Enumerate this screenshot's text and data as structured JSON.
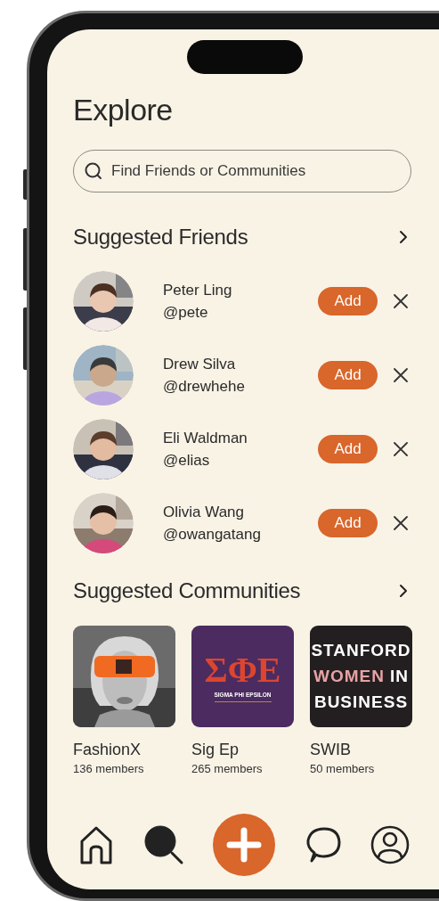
{
  "title": "Explore",
  "search": {
    "placeholder": "Find Friends or Communities"
  },
  "friends_section": {
    "heading": "Suggested Friends",
    "friends": [
      {
        "name": "Peter Ling",
        "handle": "@pete",
        "add_label": "Add"
      },
      {
        "name": "Drew Silva",
        "handle": "@drewhehe",
        "add_label": "Add"
      },
      {
        "name": "Eli Waldman",
        "handle": "@elias",
        "add_label": "Add"
      },
      {
        "name": "Olivia Wang",
        "handle": "@owangatang",
        "add_label": "Add"
      }
    ]
  },
  "communities_section": {
    "heading": "Suggested Communities",
    "communities": [
      {
        "name": "FashionX",
        "members": "136 members"
      },
      {
        "name": "Sig Ep",
        "members": "265 members",
        "cover": {
          "kind": "crest",
          "color": "#4b2b60",
          "lines": [
            {
              "parts": [
                {
                  "text": "ΣΦΕ",
                  "color": "#dc4530"
                }
              ]
            },
            {
              "parts": [
                {
                  "text": "SIGMA PHI EPSILON",
                  "color": "#ffffff"
                }
              ]
            }
          ]
        }
      },
      {
        "name": "SWIB",
        "members": "50 members",
        "cover": {
          "kind": "wordmark",
          "color": "#231f20",
          "lines": [
            {
              "parts": [
                {
                  "text": "STANFORD",
                  "color": "#ffffff"
                }
              ]
            },
            {
              "parts": [
                {
                  "text": "WOMEN",
                  "color": "#e8a2a4"
                },
                {
                  "text": "IN",
                  "color": "#ffffff"
                }
              ]
            },
            {
              "parts": [
                {
                  "text": "BUSINESS",
                  "color": "#ffffff"
                }
              ]
            }
          ]
        }
      }
    ]
  },
  "nav": [
    {
      "kind": "home",
      "selected": false
    },
    {
      "kind": "search",
      "selected": true
    },
    {
      "kind": "create",
      "selected": false
    },
    {
      "kind": "chat",
      "selected": false
    },
    {
      "kind": "profile",
      "selected": false
    }
  ]
}
